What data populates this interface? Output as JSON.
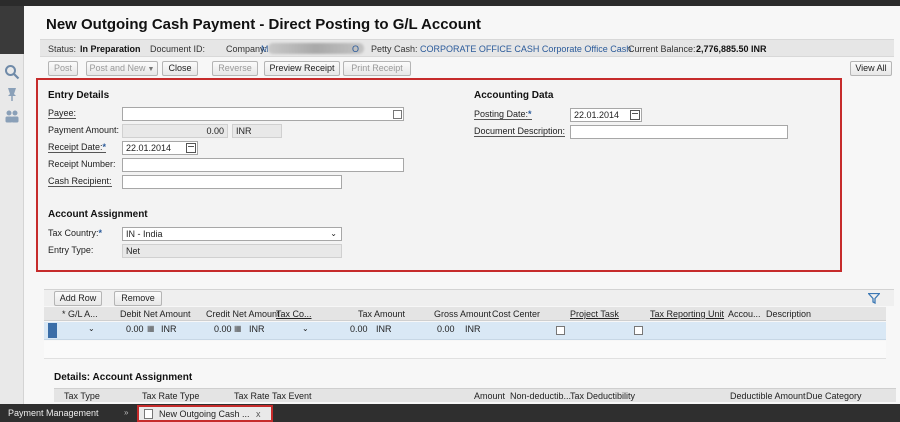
{
  "title": "New Outgoing Cash Payment - Direct Posting to G/L Account",
  "status": {
    "status_label": "Status:",
    "status_value": "In Preparation",
    "document_id_label": "Document ID:",
    "company_label": "Company:",
    "company_value": "M",
    "company_suffix": "O",
    "petty_cash_label": "Petty Cash:",
    "petty_cash_value": "CORPORATE OFFICE CASH Corporate Office Cash",
    "balance_label": "Current Balance:",
    "balance_value": "2,776,885.50",
    "balance_currency": "INR"
  },
  "toolbar": {
    "post": "Post",
    "post_and_new": "Post and New",
    "close": "Close",
    "reverse": "Reverse",
    "preview_receipt": "Preview Receipt",
    "print_receipt": "Print Receipt",
    "view_all": "View All"
  },
  "entry_details": {
    "heading": "Entry Details",
    "payee_label": "Payee:",
    "payee_value": "",
    "payment_amount_label": "Payment Amount:",
    "payment_amount_value": "0.00",
    "payment_currency": "INR",
    "receipt_date_label": "Receipt Date:",
    "receipt_date_value": "22.01.2014",
    "receipt_number_label": "Receipt Number:",
    "receipt_number_value": "",
    "cash_recipient_label": "Cash Recipient:",
    "cash_recipient_value": ""
  },
  "accounting_data": {
    "heading": "Accounting Data",
    "posting_date_label": "Posting Date:",
    "posting_date_value": "22.01.2014",
    "doc_desc_label": "Document Description:",
    "doc_desc_value": ""
  },
  "account_assignment": {
    "heading": "Account Assignment",
    "tax_country_label": "Tax Country:",
    "tax_country_value": "IN - India",
    "entry_type_label": "Entry Type:",
    "entry_type_value": "Net"
  },
  "required_marker": "*",
  "grid": {
    "add_row": "Add Row",
    "remove": "Remove",
    "columns": [
      "* G/L A...",
      "Debit Net Amount",
      "Credit Net Amount",
      "Tax Co...",
      "Tax Amount",
      "Gross Amount",
      "Cost Center",
      "Project Task",
      "Tax Reporting Unit",
      "Accou...",
      "Description"
    ],
    "row": {
      "debit": "0.00",
      "debit_cur": "INR",
      "credit": "0.00",
      "credit_cur": "INR",
      "tax_amount": "0.00",
      "tax_cur": "INR",
      "gross": "0.00",
      "gross_cur": "INR"
    }
  },
  "details": {
    "heading": "Details: Account Assignment",
    "columns": [
      "Tax Type",
      "Tax Rate Type",
      "Tax Rate",
      "Tax Event",
      "Amount",
      "Non-deductib...",
      "Tax Deductibility",
      "Deductible Amount",
      "Due Category"
    ]
  },
  "taskbar": {
    "left": "Payment Management",
    "tab": "New Outgoing Cash ...",
    "close": "x"
  }
}
